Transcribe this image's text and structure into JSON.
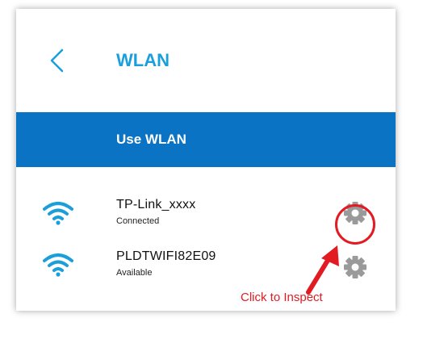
{
  "header": {
    "back_icon": "chevron-left-icon",
    "title": "WLAN"
  },
  "toggle": {
    "label": "Use WLAN"
  },
  "networks": [
    {
      "name": "TP-Link_xxxx",
      "status": "Connected",
      "icon": "wifi-icon",
      "settings_icon": "gear-icon"
    },
    {
      "name": "PLDTWIFI82E09",
      "status": "Available",
      "icon": "wifi-icon",
      "settings_icon": "gear-icon"
    }
  ],
  "annotation": {
    "callout": "Click to Inspect"
  },
  "colors": {
    "accent": "#1a9fdb",
    "toggle_bar": "#0a73c4",
    "annotation": "#e21b23",
    "gear": "#9a9a9a"
  }
}
